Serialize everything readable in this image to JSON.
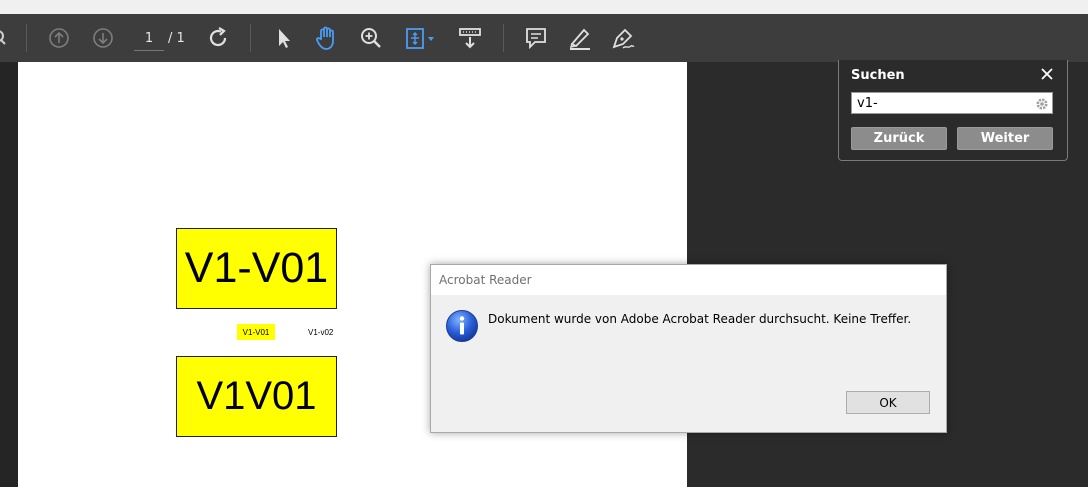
{
  "toolbar": {
    "page_current": "1",
    "page_total": "/ 1",
    "icons": [
      "search-icon",
      "prev-page-icon",
      "next-page-icon",
      "rotate-icon",
      "select-cursor-icon",
      "hand-tool-icon",
      "zoom-in-icon",
      "fit-page-icon",
      "read-mode-icon",
      "comment-icon",
      "highlight-icon",
      "sign-icon"
    ]
  },
  "document": {
    "box1_text": "V1-V01",
    "small_label1": "V1-V01",
    "small_label2": "V1-v02",
    "box2_text": "V1V01",
    "highlight_color": "#ffff00"
  },
  "search": {
    "title": "Suchen",
    "query": "v1-",
    "back_label": "Zurück",
    "next_label": "Weiter"
  },
  "dialog": {
    "title": "Acrobat Reader",
    "message": "Dokument wurde von Adobe Acrobat Reader durchsucht. Keine Treffer.",
    "ok_label": "OK"
  },
  "colors": {
    "toolbar_bg": "#3d3d3d",
    "accent_blue": "#4a9cf5",
    "workspace_bg": "#2b2b2b"
  }
}
